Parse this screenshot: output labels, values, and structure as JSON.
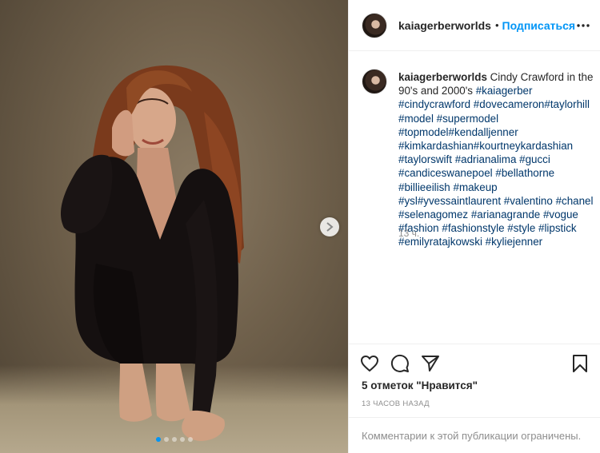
{
  "post": {
    "username": "kaiagerberworlds",
    "separator": "•",
    "follow_label": "Подписаться",
    "caption_text": "Cindy Crawford in the 90's and 2000's",
    "hashtags": [
      "#kaiagerber",
      "#cindycrawford",
      "#dovecameron",
      "#taylorhill",
      "#model",
      "#supermodel",
      "#topmodel",
      "#kendalljenner",
      "#kimkardashian",
      "#kourtneykardashian",
      "#taylorswift",
      "#adrianalima",
      "#gucci",
      "#candiceswanepoel",
      "#bellathorne",
      "#billieeilish",
      "#makeup",
      "#ysl",
      "#yvessaintlaurent",
      "#valentino",
      "#chanel",
      "#selenagomez",
      "#arianagrande",
      "#vogue",
      "#fashion",
      "#fashionstyle",
      "#style",
      "#lipstick",
      "#emilyratajkowski",
      "#kyliejenner"
    ],
    "caption_age": "13 ч.",
    "likes_text": "5 отметок \"Нравится\"",
    "timestamp": "13 часов назад",
    "comments_disabled": "Комментарии к этой публикации ограничены."
  },
  "carousel": {
    "total": 5,
    "active_index": 0
  },
  "colors": {
    "accent": "#0095f6",
    "hashtag": "#00376b",
    "muted": "#8e8e8e",
    "text": "#262626"
  },
  "icons": {
    "next": "chevron-right-icon",
    "more": "more-horizontal-icon",
    "like": "heart-icon",
    "comment": "comment-bubble-icon",
    "share": "paper-plane-icon",
    "save": "bookmark-icon"
  }
}
